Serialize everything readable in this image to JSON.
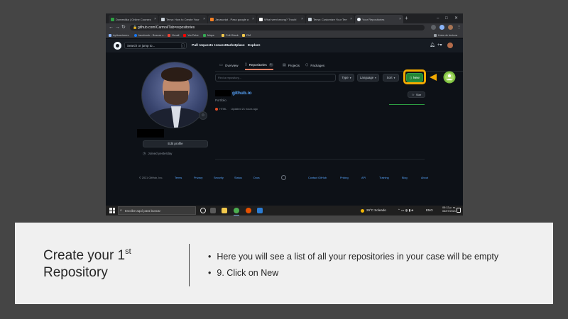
{
  "colors": {
    "slide_bg": "#454545",
    "caption_bg": "#f0f0f0",
    "github_bg": "#0d1117",
    "new_button": "#238636",
    "highlight": "#f2a900",
    "link": "#58a6ff"
  },
  "browser": {
    "tabs": [
      {
        "label": "Domestika | Online Courses"
      },
      {
        "label": "Tema: How to Create Your"
      },
      {
        "label": "Javascript - Paso google a"
      },
      {
        "label": "What went wrong? Troubl"
      },
      {
        "label": "Tema: Customize Your Terr"
      },
      {
        "label": "Your Repositories"
      }
    ],
    "url": "github.com/Carmol/Tab=repositories",
    "bookmarks": [
      {
        "label": "Aplicaciones"
      },
      {
        "label": "facebook - Buscar c..."
      },
      {
        "label": "Gmail"
      },
      {
        "label": "YouTube"
      },
      {
        "label": "Maps"
      },
      {
        "label": "Full-Stack"
      },
      {
        "label": "DM"
      }
    ],
    "reading_list": "Lista de lectura"
  },
  "github": {
    "search_placeholder": "Search or jump to...",
    "search_shortcut": "/",
    "nav": [
      "Pull requests",
      "Issues",
      "Marketplace",
      "Explore"
    ],
    "tabs": [
      {
        "label": "Overview",
        "icon": "book-icon"
      },
      {
        "label": "Repositories",
        "icon": "repo-icon",
        "count": "1"
      },
      {
        "label": "Projects",
        "icon": "project-icon"
      },
      {
        "label": "Packages",
        "icon": "package-icon"
      }
    ],
    "find_placeholder": "Find a repository...",
    "filters": {
      "type": "Type",
      "language": "Language",
      "sort": "Sort"
    },
    "new_label": "New",
    "repo": {
      "name": "github.io",
      "description": "Portfolio",
      "language": "HTML",
      "updated": "Updated 21 hours ago",
      "star_label": "Star"
    },
    "profile": {
      "edit_label": "Edit profile",
      "joined": "Joined yesterday"
    },
    "footer": {
      "copyright": "© 2021 GitHub, Inc.",
      "left_links": [
        "Terms",
        "Privacy",
        "Security",
        "Status",
        "Docs"
      ],
      "right_links": [
        "Contact GitHub",
        "Pricing",
        "API",
        "Training",
        "Blog",
        "About"
      ]
    }
  },
  "taskbar": {
    "search_placeholder": "Escribe aquí para buscar",
    "weather": "29°C Soleado",
    "lang": "ENG",
    "time": "05:12 p. m.",
    "date": "06/07/2021"
  },
  "caption": {
    "title_line1": "Create your 1",
    "title_sup": "st",
    "title_line2": "Repository",
    "bullets": [
      "Here you will see a list of all your repositories in your case will be empty",
      "9. Click on New"
    ]
  }
}
